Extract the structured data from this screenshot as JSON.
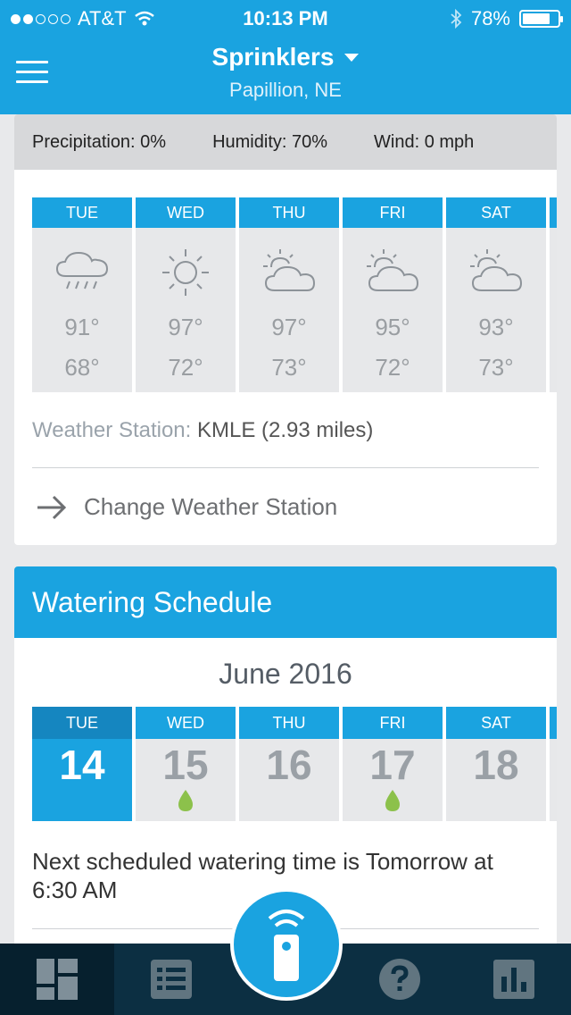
{
  "status_bar": {
    "carrier": "AT&T",
    "time": "10:13 PM",
    "battery": "78%",
    "battery_level": 0.78
  },
  "header": {
    "title": "Sprinklers",
    "subtitle": "Papillion, NE"
  },
  "weather": {
    "precipitation": "Precipitation: 0%",
    "humidity": "Humidity: 70%",
    "wind": "Wind: 0 mph",
    "forecast": [
      {
        "day": "TUE",
        "icon": "rain-icon",
        "high": "91°",
        "low": "68°"
      },
      {
        "day": "WED",
        "icon": "sun-icon",
        "high": "97°",
        "low": "72°"
      },
      {
        "day": "THU",
        "icon": "partly-cloudy-icon",
        "high": "97°",
        "low": "73°"
      },
      {
        "day": "FRI",
        "icon": "partly-cloudy-icon",
        "high": "95°",
        "low": "72°"
      },
      {
        "day": "SAT",
        "icon": "partly-cloudy-icon",
        "high": "93°",
        "low": "73°"
      }
    ],
    "station_label": "Weather Station:",
    "station_value": "KMLE (2.93 miles)",
    "change_label": "Change Weather Station"
  },
  "watering": {
    "title": "Watering Schedule",
    "month": "June 2016",
    "days": [
      {
        "day": "TUE",
        "date": "14",
        "today": true,
        "watering": false
      },
      {
        "day": "WED",
        "date": "15",
        "today": false,
        "watering": true
      },
      {
        "day": "THU",
        "date": "16",
        "today": false,
        "watering": false
      },
      {
        "day": "FRI",
        "date": "17",
        "today": false,
        "watering": true
      },
      {
        "day": "SAT",
        "date": "18",
        "today": false,
        "watering": false
      }
    ],
    "next_text": "Next scheduled watering time is Tomorrow at 6:30 AM"
  },
  "tabs": [
    {
      "name": "dashboard-icon",
      "active": true
    },
    {
      "name": "list-icon",
      "active": false
    },
    {
      "name": "remote-icon",
      "active": false
    },
    {
      "name": "help-icon",
      "active": false
    },
    {
      "name": "chart-icon",
      "active": false
    }
  ],
  "colors": {
    "accent": "#1aa3e0",
    "tabbar": "#0c2f42",
    "drop": "#8cc14b"
  }
}
